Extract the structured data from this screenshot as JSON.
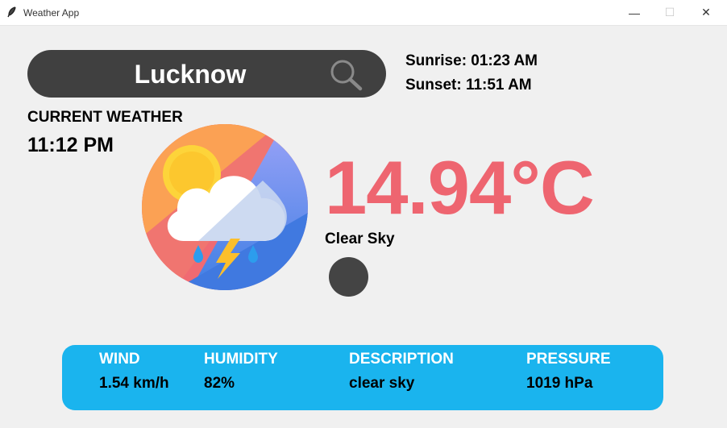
{
  "window": {
    "title": "Weather App",
    "app_icon": "feather-icon",
    "controls": {
      "minimize": "—",
      "maximize": "☐",
      "close": "✕"
    }
  },
  "search": {
    "value": "Lucknow",
    "icon": "search-icon"
  },
  "sun": {
    "sunrise": "Sunrise: 01:23 AM",
    "sunset": "Sunset: 11:51 AM"
  },
  "current": {
    "label": "CURRENT WEATHER",
    "time": "11:12 PM",
    "icon": "weather-storm-icon",
    "temperature": "14.94°C",
    "condition": "Clear Sky"
  },
  "details": {
    "wind_label": "WIND",
    "wind_value": "1.54 km/h",
    "humidity_label": "HUMIDITY",
    "humidity_value": "82%",
    "description_label": "DESCRIPTION",
    "description_value": "clear sky",
    "pressure_label": "PRESSURE",
    "pressure_value": "1019 hPa"
  },
  "colors": {
    "background": "#f0f0f0",
    "search_bar": "#404040",
    "temperature": "#ee6570",
    "info_panel": "#1ab4ee",
    "info_label": "#ffffff",
    "info_value": "#000000"
  }
}
